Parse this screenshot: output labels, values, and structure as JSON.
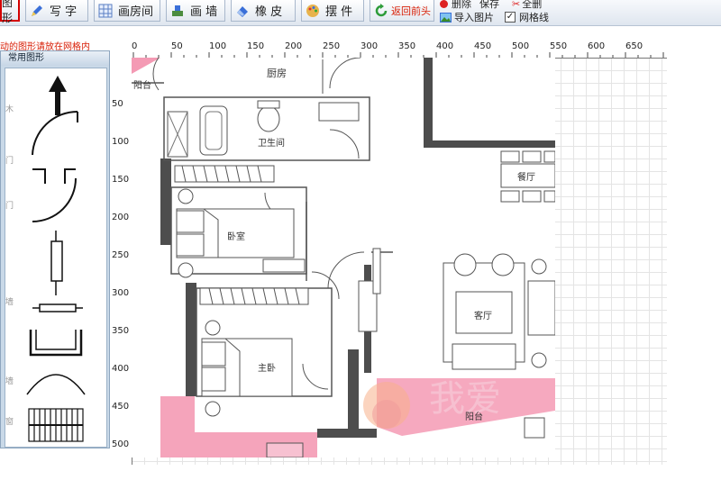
{
  "toolbar": {
    "first_label": "图形",
    "write_label": "写 字",
    "draw_room_label": "画房间",
    "draw_wall_label": "画 墙",
    "eraser_label": "橡 皮",
    "furniture_label": "摆 件",
    "back_label": "返回前头",
    "delete_label": "删除",
    "save_label": "保存",
    "all_delete_label": "全删",
    "import_label": "导入图片",
    "gridline_label": "网格线"
  },
  "hint": "动的图形请放在网格内",
  "palette": {
    "title": "常用图形",
    "side_labels": [
      "木",
      "门",
      "门",
      "墙",
      "墙",
      "窗"
    ]
  },
  "ruler": {
    "top_ticks": [
      "0",
      "50",
      "100",
      "150",
      "200",
      "250",
      "300",
      "350",
      "400",
      "450",
      "500",
      "550",
      "600",
      "650"
    ],
    "left_ticks": [
      "50",
      "100",
      "150",
      "200",
      "250",
      "300",
      "350",
      "400",
      "450",
      "500"
    ]
  },
  "floorplan": {
    "rooms": {
      "kitchen": "厨房",
      "balcony_top": "阳台",
      "bathroom": "卫生间",
      "dining": "餐厅",
      "bedroom": "卧室",
      "living": "客厅",
      "master": "主卧",
      "balcony_bottom": "阳台"
    },
    "watermark": "我爱"
  },
  "colors": {
    "wall": "#4d4d4d",
    "pink": "#f49ab4",
    "accent_red": "#d81e06"
  }
}
